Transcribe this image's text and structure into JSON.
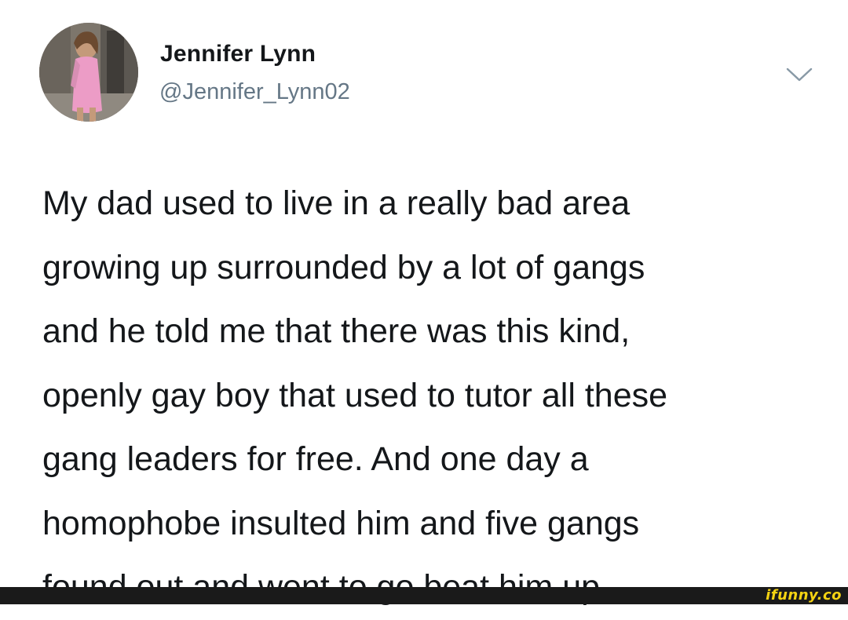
{
  "tweet": {
    "display_name": "Jennifer Lynn",
    "handle": "@Jennifer_Lynn02",
    "avatar_icon": "profile-photo",
    "menu_icon": "chevron-down-icon",
    "text_lines": [
      "My dad used to live in a really bad area",
      "growing up surrounded by a lot of gangs",
      "and he told me that there was this kind,",
      "openly gay boy that used to tutor all these",
      "gang leaders for free. And one day a",
      "homophobe insulted him and five gangs",
      "found out and went to go beat him up"
    ]
  },
  "watermark": {
    "text": "ifunny.co",
    "color": "#f5d312"
  }
}
